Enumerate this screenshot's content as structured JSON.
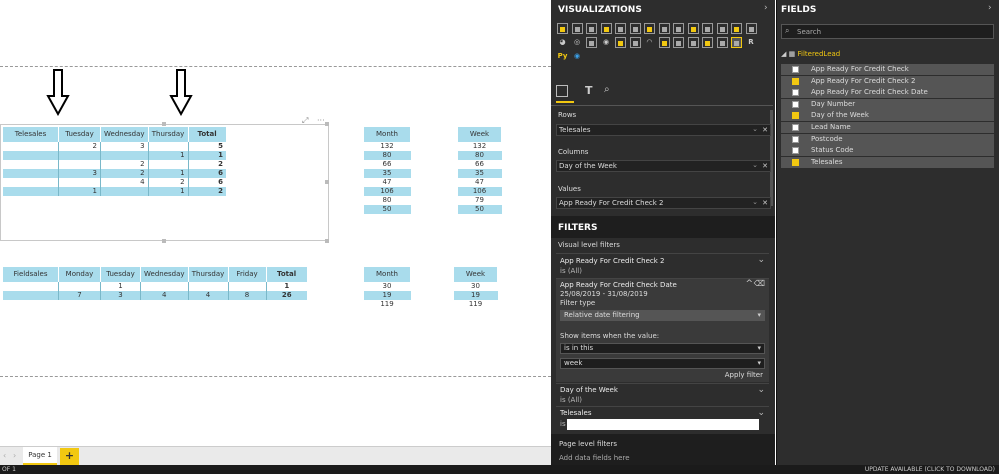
{
  "canvas": {
    "telesales_table": {
      "headers": [
        "Telesales",
        "Tuesday",
        "Wednesday",
        "Thursday",
        "Total"
      ],
      "rows": [
        [
          "",
          "2",
          "3",
          "",
          "5"
        ],
        [
          "",
          "",
          "",
          "1",
          "1"
        ],
        [
          "",
          "",
          "2",
          "",
          "2"
        ],
        [
          "",
          "3",
          "2",
          "1",
          "6"
        ],
        [
          "",
          "",
          "4",
          "2",
          "6"
        ],
        [
          "",
          "1",
          "",
          "1",
          "2"
        ]
      ]
    },
    "month_table_1": {
      "header": "Month",
      "values": [
        "132",
        "80",
        "66",
        "35",
        "47",
        "106",
        "80",
        "50"
      ]
    },
    "week_table_1": {
      "header": "Week",
      "values": [
        "132",
        "80",
        "66",
        "35",
        "47",
        "106",
        "79",
        "50"
      ]
    },
    "fieldsales_table": {
      "headers": [
        "Fieldsales",
        "Monday",
        "Tuesday",
        "Wednesday",
        "Thursday",
        "Friday",
        "Total"
      ],
      "rows": [
        [
          "",
          "",
          "1",
          "",
          "",
          "",
          "1"
        ],
        [
          "",
          "7",
          "3",
          "4",
          "4",
          "8",
          "26"
        ]
      ]
    },
    "month_table_2": {
      "header": "Month",
      "values": [
        "30",
        "19",
        "119"
      ]
    },
    "week_table_2": {
      "header": "Week",
      "values": [
        "30",
        "19",
        "119"
      ]
    }
  },
  "tabs": {
    "page1": "Page 1",
    "add": "+"
  },
  "status_bar": {
    "left": "OF 1",
    "right": "UPDATE AVAILABLE (CLICK TO DOWNLOAD)"
  },
  "visualizations": {
    "title": "VISUALIZATIONS",
    "wells": {
      "rows_label": "Rows",
      "rows_value": "Telesales",
      "columns_label": "Columns",
      "columns_value": "Day of the Week",
      "values_label": "Values",
      "values_value": "App Ready For Credit Check 2"
    }
  },
  "filters": {
    "title": "FILTERS",
    "visual_level": "Visual level filters",
    "f1_name": "App Ready For Credit Check 2",
    "f1_state": "is (All)",
    "f2_name": "App Ready For Credit Check Date",
    "f2_range": "25/08/2019 - 31/08/2019",
    "filter_type_label": "Filter type",
    "filter_type_value": "Relative date filtering",
    "show_items_label": "Show items when the value:",
    "show_items_op": "is in this",
    "show_items_unit": "week",
    "apply": "Apply filter",
    "f3_name": "Day of the Week",
    "f3_state": "is (All)",
    "f4_name": "Telesales",
    "f4_state": "is",
    "page_level": "Page level filters",
    "add_fields": "Add data fields here"
  },
  "fields": {
    "title": "FIELDS",
    "search_placeholder": "Search",
    "table_name": "FilteredLead",
    "items": [
      {
        "label": "App Ready For Credit Check",
        "checked": false
      },
      {
        "label": "App Ready For Credit Check 2",
        "checked": true
      },
      {
        "label": "App Ready For Credit Check Date",
        "checked": false
      },
      {
        "label": "Day Number",
        "checked": false
      },
      {
        "label": "Day of the Week",
        "checked": true
      },
      {
        "label": "Lead Name",
        "checked": false
      },
      {
        "label": "Postcode",
        "checked": false
      },
      {
        "label": "Status Code",
        "checked": false
      },
      {
        "label": "Telesales",
        "checked": true
      }
    ]
  },
  "colors": {
    "accent": "#f2c811",
    "table_header": "#a9dcec",
    "pane_bg": "#2d2d2d"
  }
}
